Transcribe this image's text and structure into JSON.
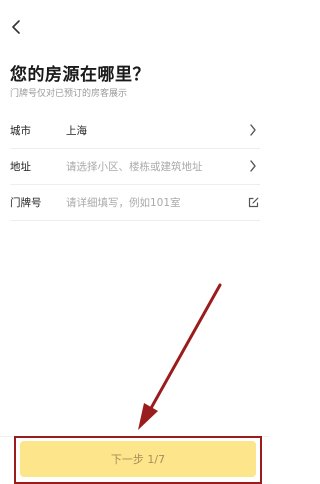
{
  "header": {
    "back_icon": "chevron-left-icon",
    "title": "您的房源在哪里？",
    "subtitle": "门牌号仅对已预订的房客展示"
  },
  "form": {
    "city": {
      "label": "城市",
      "value": "上海",
      "icon": "chevron-right-icon"
    },
    "address": {
      "label": "地址",
      "placeholder": "请选择小区、楼栋或建筑地址",
      "icon": "chevron-right-icon"
    },
    "door": {
      "label": "门牌号",
      "placeholder": "请详细填写，例如101室",
      "icon": "edit-icon"
    }
  },
  "footer": {
    "next_label": "下一步 1/7"
  },
  "colors": {
    "button_bg": "#fde58c",
    "button_text": "#a98e5a",
    "annotation": "#9b1c1c"
  }
}
